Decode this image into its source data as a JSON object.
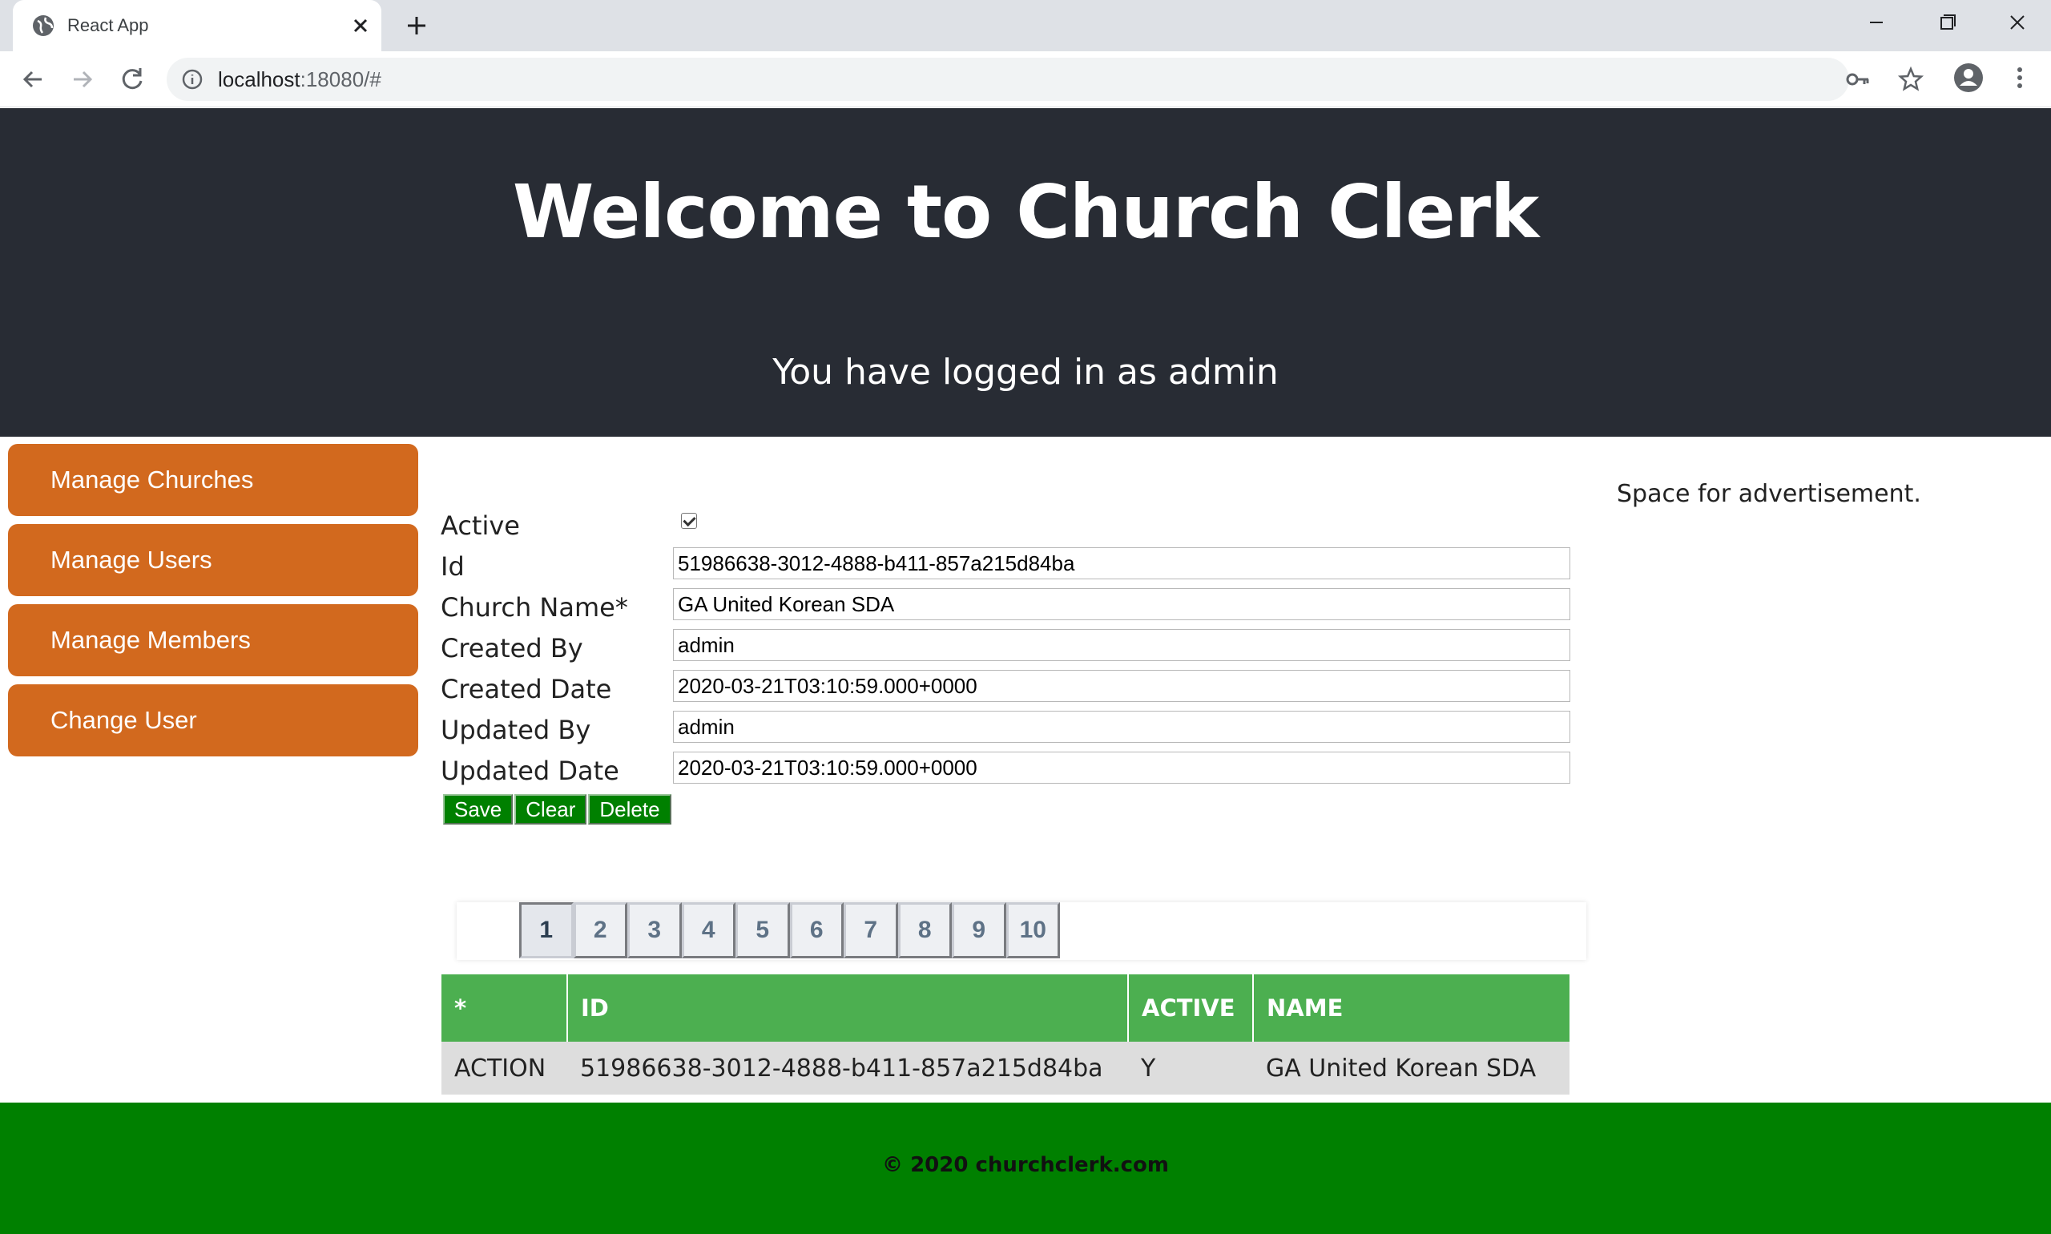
{
  "browser": {
    "tab_title": "React App",
    "url_host": "localhost",
    "url_rest": ":18080/#"
  },
  "header": {
    "title": "Welcome to Church Clerk",
    "subtitle": "You have logged in as admin"
  },
  "sidebar": {
    "items": [
      {
        "label": "Manage Churches"
      },
      {
        "label": "Manage Users"
      },
      {
        "label": "Manage Members"
      },
      {
        "label": "Change User"
      }
    ]
  },
  "form": {
    "active_label": "Active",
    "active_checked": true,
    "fields": [
      {
        "label": "Id",
        "value": "51986638-3012-4888-b411-857a215d84ba"
      },
      {
        "label": "Church Name*",
        "value": "GA United Korean SDA"
      },
      {
        "label": "Created By",
        "value": "admin"
      },
      {
        "label": "Created Date",
        "value": "2020-03-21T03:10:59.000+0000"
      },
      {
        "label": "Updated By",
        "value": "admin"
      },
      {
        "label": "Updated Date",
        "value": "2020-03-21T03:10:59.000+0000"
      }
    ],
    "buttons": {
      "save": "Save",
      "clear": "Clear",
      "delete": "Delete"
    }
  },
  "pagination": {
    "pages": [
      "1",
      "2",
      "3",
      "4",
      "5",
      "6",
      "7",
      "8",
      "9",
      "10"
    ],
    "current": "1"
  },
  "table": {
    "headers": [
      "*",
      "ID",
      "ACTIVE",
      "NAME"
    ],
    "rows": [
      [
        "ACTION",
        "51986638-3012-4888-b411-857a215d84ba",
        "Y",
        "GA United Korean SDA"
      ]
    ]
  },
  "ad": {
    "text": "Space for advertisement."
  },
  "footer": {
    "text": "© 2020 churchclerk.com"
  },
  "colors": {
    "header_bg": "#282c34",
    "sidebar_button": "#d2691e",
    "action_button": "#008000",
    "table_header": "#4caf50",
    "footer_bg": "#008000"
  }
}
